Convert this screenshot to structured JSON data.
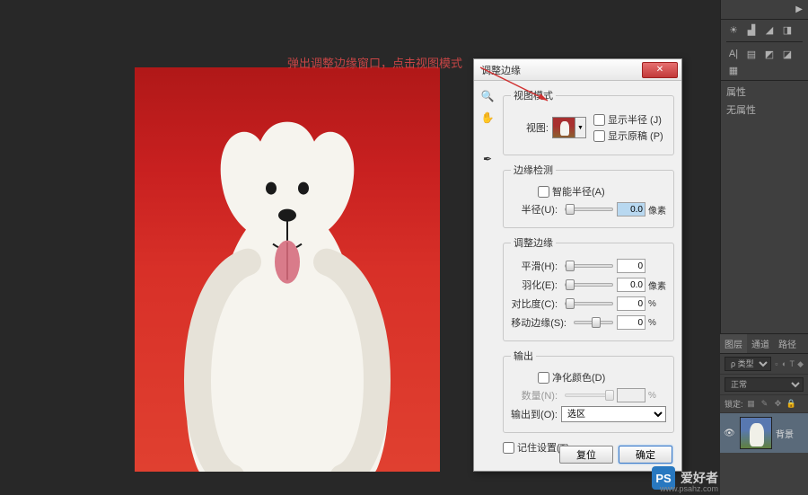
{
  "annotation": "弹出调整边缘窗口，点击视图模式",
  "dialog": {
    "title": "调整边缘",
    "view_section": {
      "legend": "视图模式",
      "view_label": "视图:",
      "show_radius": "显示半径 (J)",
      "show_original": "显示原稿 (P)"
    },
    "edge_detect": {
      "legend": "边缘检测",
      "smart_radius": "智能半径(A)",
      "radius_label": "半径(U):",
      "radius_value": "0.0",
      "radius_unit": "像素"
    },
    "adjust_edge": {
      "legend": "调整边缘",
      "smooth_label": "平滑(H):",
      "smooth_value": "0",
      "feather_label": "羽化(E):",
      "feather_value": "0.0",
      "feather_unit": "像素",
      "contrast_label": "对比度(C):",
      "contrast_value": "0",
      "contrast_unit": "%",
      "shift_label": "移动边缘(S):",
      "shift_value": "0",
      "shift_unit": "%"
    },
    "output": {
      "legend": "输出",
      "decontaminate": "净化颜色(D)",
      "amount_label": "数量(N):",
      "amount_unit": "%",
      "output_to_label": "输出到(O):",
      "output_to_value": "选区"
    },
    "remember": "记住设置(T)",
    "reset_btn": "复位",
    "ok_btn": "确定"
  },
  "right_panel": {
    "properties": "属性",
    "no_properties": "无属性"
  },
  "layers": {
    "tab_layers": "图层",
    "tab_channels": "通道",
    "tab_paths": "路径",
    "kind": "ρ 类型",
    "blend_mode": "正常",
    "lock_label": "锁定:",
    "layer_name": "背景"
  },
  "watermark": {
    "logo": "PS",
    "text": "爱好者",
    "url": "www.psahz.com"
  }
}
